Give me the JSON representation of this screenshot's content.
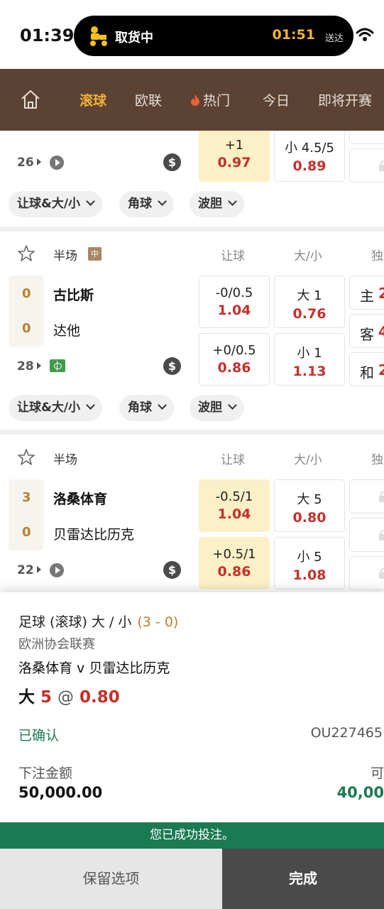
{
  "status_bar": {
    "time": "01:39",
    "activity_label": "取货中",
    "eta": "01:51",
    "eta_suffix": "送达"
  },
  "nav": {
    "tabs": [
      {
        "label": "滚球",
        "active": true
      },
      {
        "label": "欧联",
        "active": false
      },
      {
        "label": "热门",
        "active": false,
        "icon": "fire-icon"
      },
      {
        "label": "今日",
        "active": false
      },
      {
        "label": "即将开赛",
        "active": false
      }
    ]
  },
  "match_partial": {
    "minute": "26",
    "handicap": {
      "line": "+1",
      "odds": "0.97"
    },
    "total": {
      "line": "小 4.5/5",
      "odds": "0.89"
    }
  },
  "chips": {
    "handicap_total": "让球&大/小",
    "corners": "角球",
    "correct_score": "波胆"
  },
  "match2": {
    "period": "半场",
    "badge": "中",
    "headers": {
      "handicap": "让球",
      "total": "大/小",
      "oneXtwo": "独"
    },
    "home": {
      "name": "古比斯",
      "score": "0"
    },
    "away": {
      "name": "达他",
      "score": "0"
    },
    "minute": "28",
    "odds": [
      {
        "line": "-0/0.5",
        "val": "1.04"
      },
      {
        "line": "大 1",
        "val": "0.76"
      },
      {
        "line": "+0/0.5",
        "val": "0.86"
      },
      {
        "line": "小 1",
        "val": "1.13"
      }
    ],
    "x12": [
      {
        "label": "主",
        "val": "2"
      },
      {
        "label": "客",
        "val": "4"
      },
      {
        "label": "和",
        "val": "2"
      }
    ]
  },
  "match3": {
    "period": "半场",
    "headers": {
      "handicap": "让球",
      "total": "大/小",
      "oneXtwo": "独"
    },
    "home": {
      "name": "洛桑体育",
      "score": "3"
    },
    "away": {
      "name": "贝雷达比历克",
      "score": "0"
    },
    "minute": "22",
    "odds": [
      {
        "line": "-0.5/1",
        "val": "1.04"
      },
      {
        "line": "大 5",
        "val": "0.80"
      },
      {
        "line": "+0.5/1",
        "val": "0.86"
      },
      {
        "line": "小 5",
        "val": "1.08"
      }
    ]
  },
  "bet_slip": {
    "market": "足球 (滚球) 大 / 小",
    "score": "(3 - 0)",
    "league": "欧洲协会联赛",
    "fixture": "洛桑体育 v 贝雷达比历克",
    "selection": "大",
    "selection_line": "5",
    "at": "@",
    "odds": "0.80",
    "status": "已确认",
    "ticket_id": "OU227465",
    "stake_label": "下注金额",
    "stake": "50,000.00",
    "win_label_partial": "可",
    "win_partial": "40,00"
  },
  "banner": "您已成功投注。",
  "buttons": {
    "keep": "保留选项",
    "done": "完成"
  },
  "colors": {
    "nav_bg": "#5b4232",
    "accent": "#f1b03a",
    "odds_red": "#c4302b",
    "success_green": "#1a7a52",
    "highlight": "#fdf0c6"
  }
}
